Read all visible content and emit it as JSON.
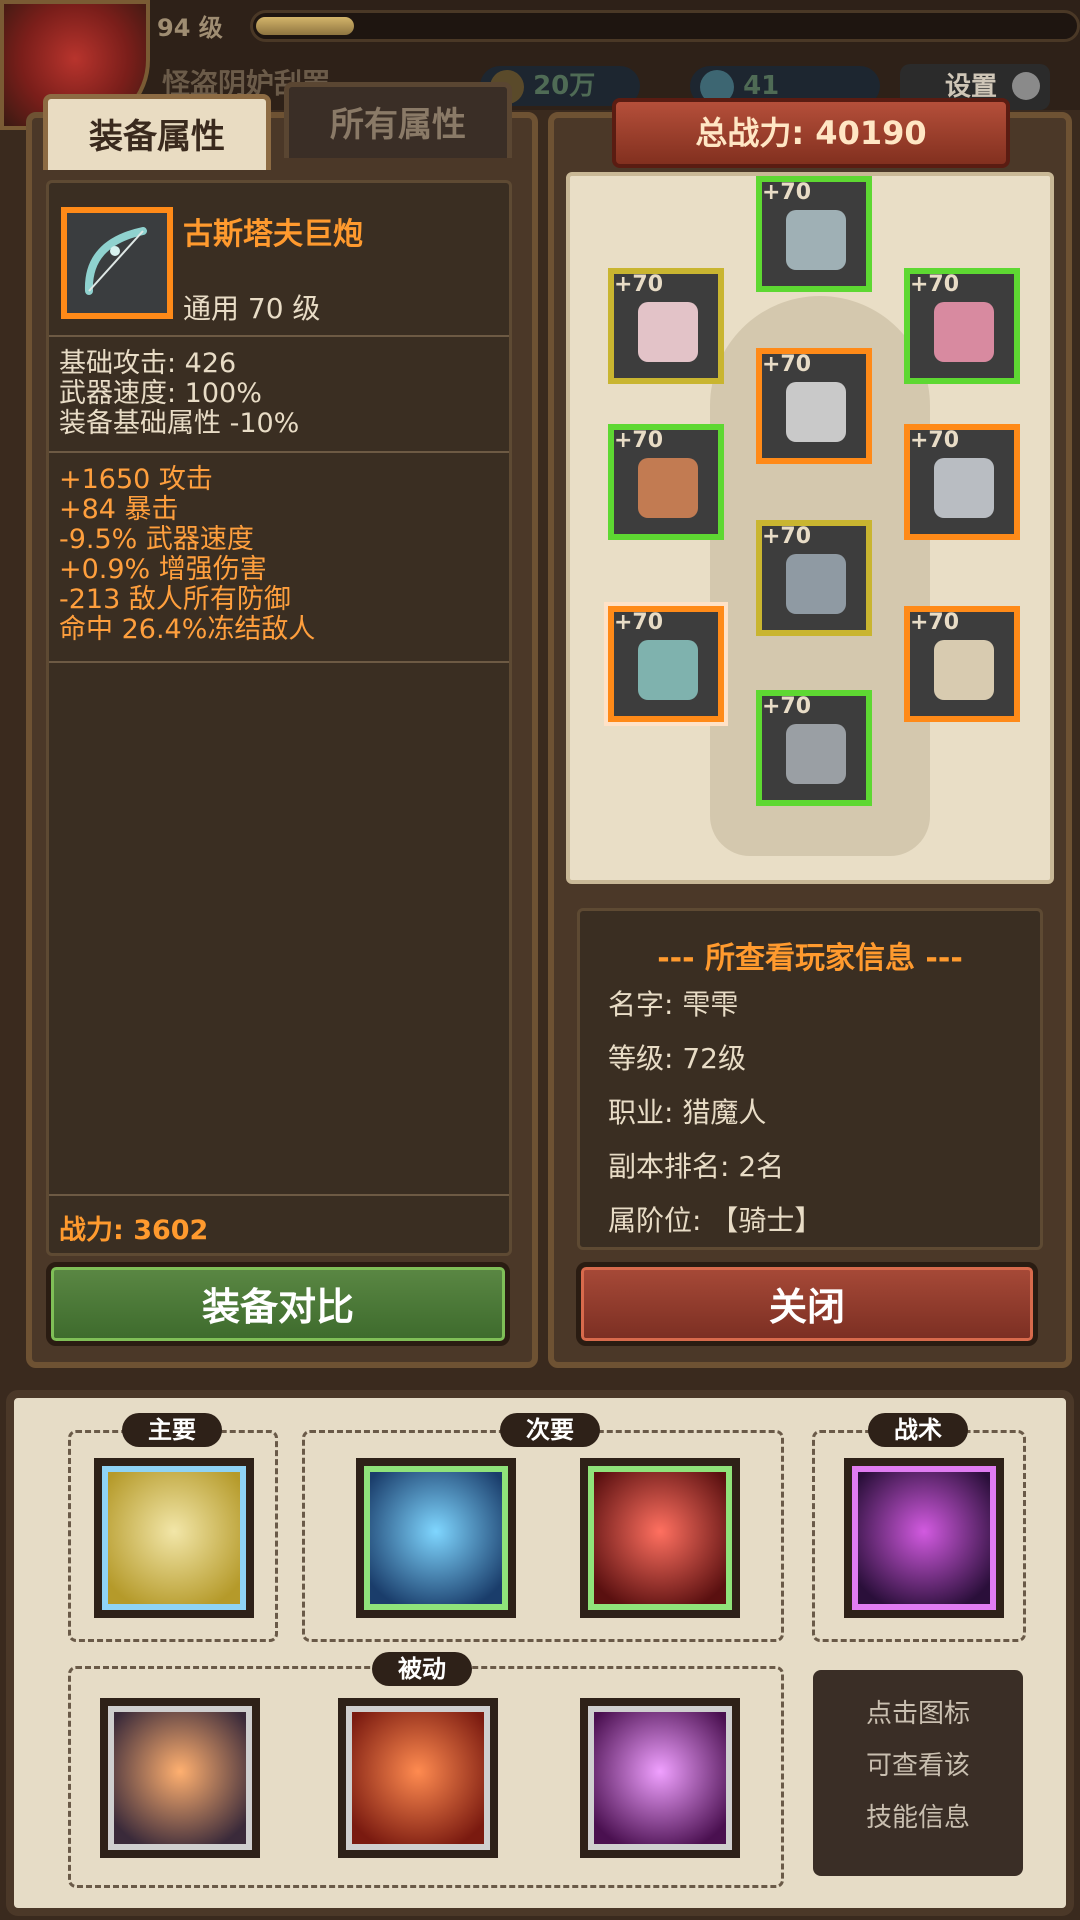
{
  "top": {
    "level": "94 级",
    "xp_fraction": 0.12,
    "subtitle": "怪盗阴妒刮罢",
    "gold": "20万",
    "gems": "41",
    "settings": "设置"
  },
  "tabs": [
    "装备属性",
    "所有属性"
  ],
  "item": {
    "name": "古斯塔夫巨炮",
    "type": "通用 70 级",
    "base_stats": [
      "基础攻击: 426",
      "武器速度: 100%",
      "装备基础属性 -10%"
    ],
    "affixes": [
      "+1650 攻击",
      "+84 暴击",
      "-9.5% 武器速度",
      "+0.9% 增强伤害",
      "-213 敌人所有防御",
      "命中 26.4%冻结敌人"
    ],
    "power": "战力: 3602",
    "icon": "bow-icon"
  },
  "compare_button": "装备对比",
  "total_power": "总战力: 40190",
  "equipment": {
    "slots": [
      {
        "name": "helmet",
        "level": "+70",
        "rarity": "green",
        "icon": "helmet-icon",
        "color": "#9fb0b5"
      },
      {
        "name": "ring",
        "level": "+70",
        "rarity": "yellow",
        "icon": "ring-icon",
        "color": "#e3c3c8"
      },
      {
        "name": "necklace",
        "level": "+70",
        "rarity": "green",
        "icon": "necklace-icon",
        "color": "#d88aa0"
      },
      {
        "name": "armor",
        "level": "+70",
        "rarity": "orange",
        "icon": "armor-icon",
        "color": "#c9c9c9"
      },
      {
        "name": "bracer",
        "level": "+70",
        "rarity": "green",
        "icon": "bracer-icon",
        "color": "#c27b52"
      },
      {
        "name": "glove",
        "level": "+70",
        "rarity": "orange",
        "icon": "glove-icon",
        "color": "#b9bdc2"
      },
      {
        "name": "pants",
        "level": "+70",
        "rarity": "yellow",
        "icon": "pants-icon",
        "color": "#8f9aa3"
      },
      {
        "name": "weapon",
        "level": "+70",
        "rarity": "selected",
        "icon": "bow-icon",
        "color": "#7fb2ae"
      },
      {
        "name": "shield",
        "level": "+70",
        "rarity": "orange",
        "icon": "shield-icon",
        "color": "#d8cbb0"
      },
      {
        "name": "boots",
        "level": "+70",
        "rarity": "green",
        "icon": "boots-icon",
        "color": "#9a9fa4"
      }
    ]
  },
  "player_info": {
    "title": "--- 所查看玩家信息 ---",
    "rows": [
      "名字: 雫雫",
      "等级: 72级",
      "职业: 猎魔人",
      "副本排名: 2名",
      "属阶位: 【骑士】"
    ]
  },
  "close_button": "关闭",
  "skills": {
    "groups": [
      "主要",
      "次要",
      "战术",
      "被动"
    ],
    "hint": [
      "点击图标",
      "可查看该",
      "技能信息"
    ],
    "icons": [
      {
        "name": "primary-skill-icon",
        "colors": [
          "#f2e6a8",
          "#b59a2a"
        ],
        "border": "#8fd3f5"
      },
      {
        "name": "secondary-skill-1-icon",
        "colors": [
          "#7fd6ff",
          "#1a3d6b"
        ],
        "border": "#8fe37a"
      },
      {
        "name": "secondary-skill-2-icon",
        "colors": [
          "#ff7060",
          "#5a1010"
        ],
        "border": "#8fe37a"
      },
      {
        "name": "tactic-skill-icon",
        "colors": [
          "#d25ae0",
          "#2a0f3a"
        ],
        "border": "#e07cf2"
      },
      {
        "name": "passive-skill-1-icon",
        "colors": [
          "#ffb070",
          "#3a2a3a"
        ],
        "border": "#cfcfcf"
      },
      {
        "name": "passive-skill-2-icon",
        "colors": [
          "#ff8b50",
          "#7a1a10"
        ],
        "border": "#cfcfcf"
      },
      {
        "name": "passive-skill-3-icon",
        "colors": [
          "#f0a0ff",
          "#4a1050"
        ],
        "border": "#cfcfcf"
      }
    ]
  }
}
